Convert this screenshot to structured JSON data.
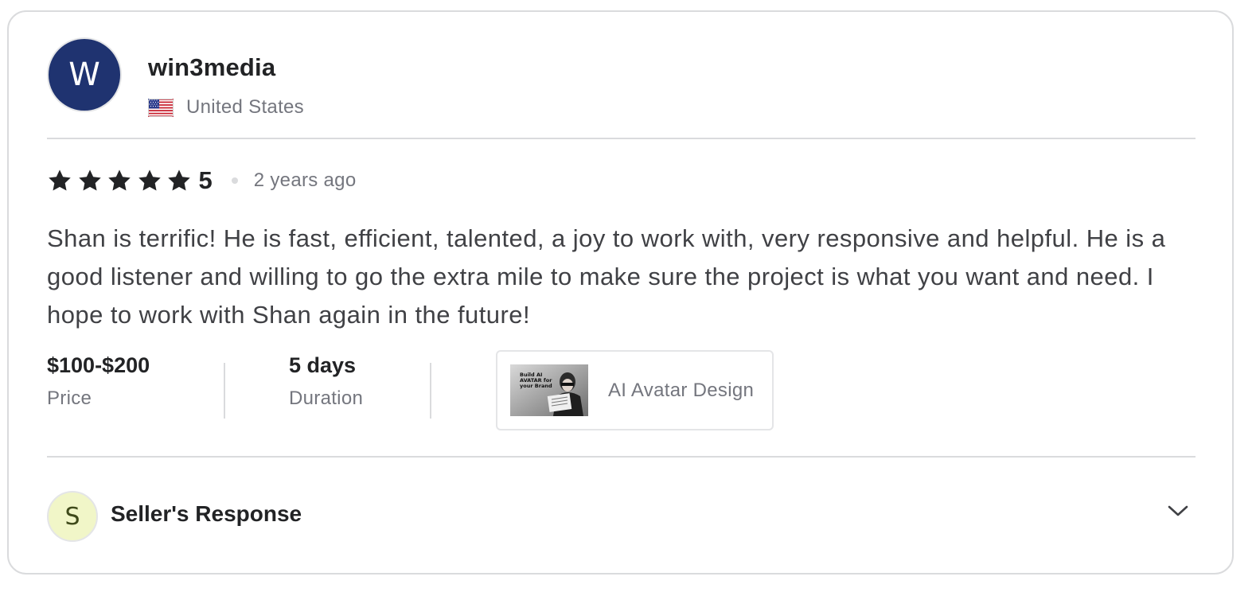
{
  "reviewer": {
    "avatar_letter": "W",
    "avatar_color": "#1f3370",
    "username": "win3media",
    "country": "United States",
    "flag_icon": "us-flag-icon"
  },
  "rating": {
    "value": "5",
    "stars": 5,
    "time_ago": "2 years ago"
  },
  "review": {
    "text": "Shan is terrific! He is fast, efficient, talented, a joy to work with, very responsive and helpful. He is a good listener and willing to go the extra mile to make sure the project is what you want and need. I hope to work with Shan again in the future!"
  },
  "meta": {
    "price_value": "$100-$200",
    "price_label": "Price",
    "duration_value": "5 days",
    "duration_label": "Duration"
  },
  "gig": {
    "title": "AI Avatar Design",
    "thumbnail_text": "Build AI AVATAR for your Brand"
  },
  "seller_response": {
    "avatar_letter": "S",
    "avatar_color": "#f1f6c8",
    "label": "Seller's Response",
    "toggle_icon": "chevron-down-icon"
  }
}
